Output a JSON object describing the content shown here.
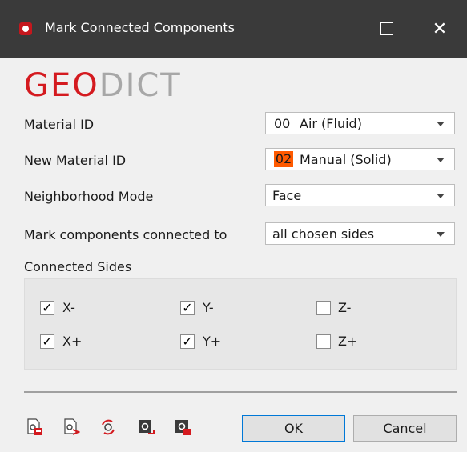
{
  "window": {
    "title": "Mark Connected Components"
  },
  "logo": {
    "geo": "GEO",
    "dict": "DICT"
  },
  "form": {
    "material_id": {
      "label": "Material ID",
      "code": "00",
      "value": "Air (Fluid)"
    },
    "new_material_id": {
      "label": "New Material ID",
      "code": "02",
      "value": "Manual (Solid)"
    },
    "neighborhood_mode": {
      "label": "Neighborhood Mode",
      "value": "Face"
    },
    "mark_components": {
      "label": "Mark components connected to",
      "value": "all chosen sides"
    }
  },
  "connected_sides": {
    "label": "Connected Sides",
    "items": [
      {
        "label": "X-",
        "checked": true
      },
      {
        "label": "Y-",
        "checked": true
      },
      {
        "label": "Z-",
        "checked": false
      },
      {
        "label": "X+",
        "checked": true
      },
      {
        "label": "Y+",
        "checked": true
      },
      {
        "label": "Z+",
        "checked": false
      }
    ]
  },
  "checkmark": "✓",
  "toolbar_icons": [
    "save-settings-icon",
    "load-settings-icon",
    "reset-icon",
    "macro-icon",
    "options-icon"
  ],
  "buttons": {
    "ok": "OK",
    "cancel": "Cancel"
  },
  "colors": {
    "titlebar": "#3a3a3a",
    "brand_red": "#d41a1f",
    "highlight": "#ff5a00",
    "focus_border": "#0078d7"
  }
}
